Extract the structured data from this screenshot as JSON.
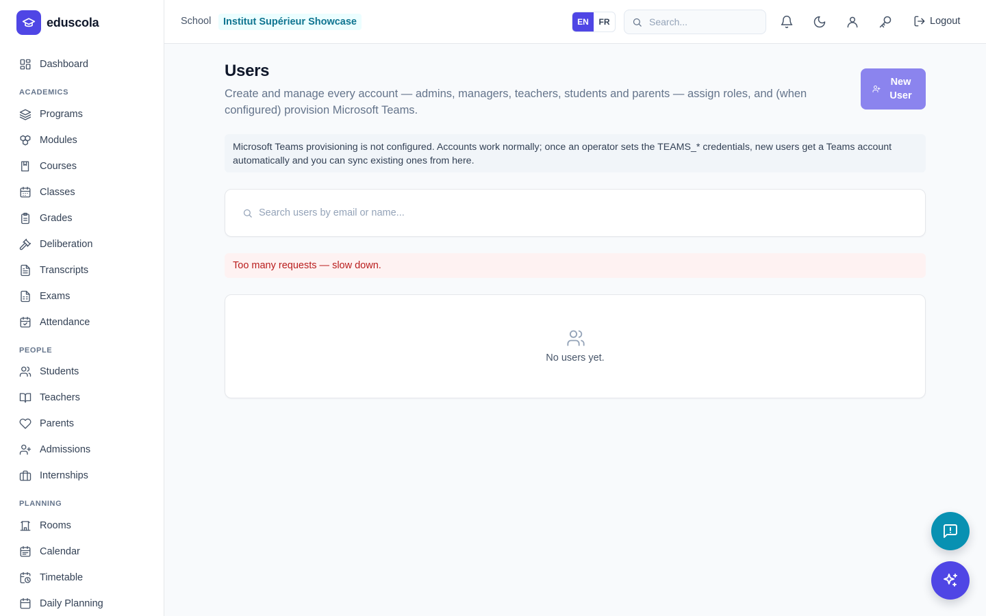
{
  "brand": {
    "name": "eduscola"
  },
  "sidebar": {
    "dashboard": "Dashboard",
    "sections": {
      "academics": "ACADEMICS",
      "people": "PEOPLE",
      "planning": "PLANNING"
    },
    "academics": [
      "Programs",
      "Modules",
      "Courses",
      "Classes",
      "Grades",
      "Deliberation",
      "Transcripts",
      "Exams",
      "Attendance"
    ],
    "people": [
      "Students",
      "Teachers",
      "Parents",
      "Admissions",
      "Internships"
    ],
    "planning": [
      "Rooms",
      "Calendar",
      "Timetable",
      "Daily Planning"
    ]
  },
  "header": {
    "school_label": "School",
    "school_name": "Institut Supérieur Showcase",
    "lang_en": "EN",
    "lang_fr": "FR",
    "active_lang": "EN",
    "search_placeholder": "Search...",
    "logout": "Logout"
  },
  "main": {
    "title": "Users",
    "description": "Create and manage every account — admins, managers, teachers, students and parents — assign roles, and (when configured) provision Microsoft Teams.",
    "new_user_label": "New User",
    "info_notice": "Microsoft Teams provisioning is not configured. Accounts work normally; once an operator sets the TEAMS_* credentials, new users get a Teams account automatically and you can sync existing ones from here.",
    "search_placeholder": "Search users by email or name...",
    "error_message": "Too many requests — slow down.",
    "empty_state": "No users yet."
  },
  "colors": {
    "accent": "#4f46e5",
    "accent_muted": "#8b84ee",
    "chat_fab": "#0891b2",
    "error_bg": "#fef2f2",
    "error_text": "#b91c1c"
  },
  "icons": {
    "dashboard": "layout-grid-icon",
    "programs": "layers-icon",
    "modules": "boxes-icon",
    "courses": "book-icon",
    "classes": "calendar-icon",
    "grades": "clipboard-icon",
    "deliberation": "gavel-icon",
    "transcripts": "file-text-icon",
    "exams": "file-spreadsheet-icon",
    "attendance": "calendar-check-icon",
    "students": "users-icon",
    "teachers": "open-book-icon",
    "parents": "heart-icon",
    "admissions": "user-plus-icon",
    "internships": "briefcase-icon",
    "rooms": "building-icon",
    "calendar": "calendar-days-icon",
    "timetable": "calendar-clock-icon",
    "daily_planning": "calendar-list-icon"
  }
}
